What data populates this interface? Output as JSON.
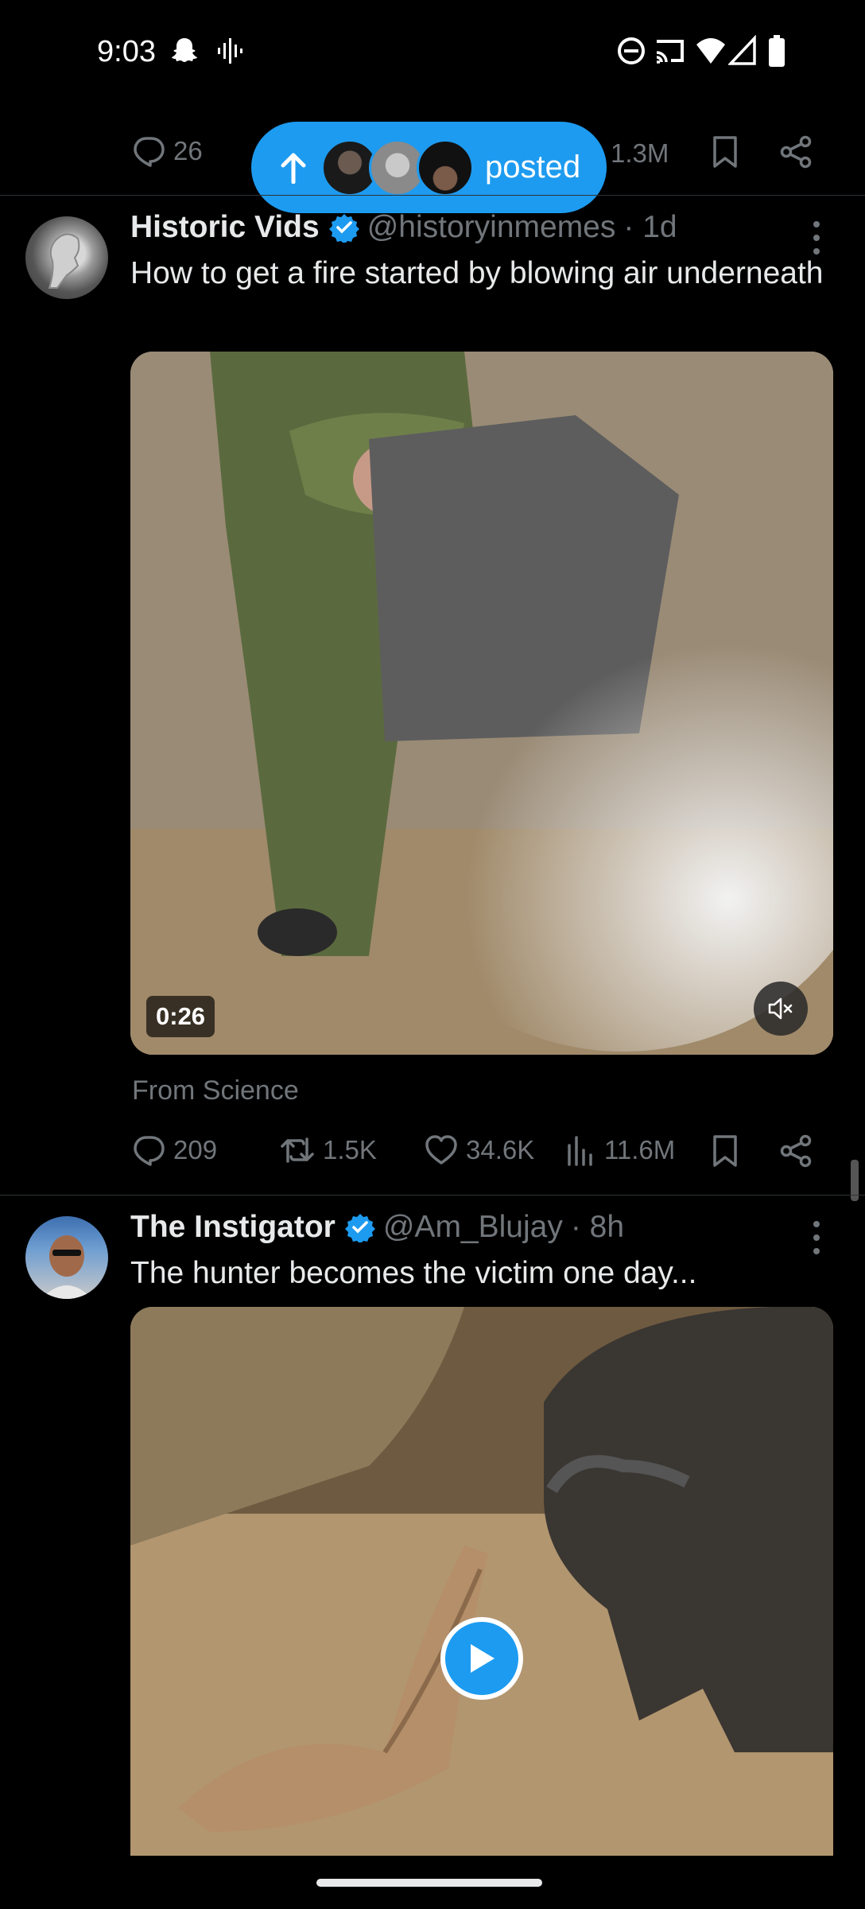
{
  "status_bar": {
    "time": "9:03",
    "left_icons": [
      "snapchat-icon",
      "voice-wave-icon"
    ],
    "right_icons": [
      "dnd-icon",
      "cast-icon",
      "wifi-icon",
      "signal-icon",
      "battery-icon"
    ]
  },
  "previous_tweet": {
    "replies": "26",
    "views": "1.3M"
  },
  "new_posts_pill": {
    "label": "posted"
  },
  "tweets": [
    {
      "display_name": "Historic Vids",
      "handle": "@historyinmemes",
      "time": "· 1d",
      "text": "How to get a fire started by blowing air underneath",
      "video_duration": "0:26",
      "source": "From Science",
      "replies": "209",
      "reposts": "1.5K",
      "likes": "34.6K",
      "views": "11.6M"
    },
    {
      "display_name": "The Instigator",
      "handle": "@Am_Blujay",
      "time": "· 8h",
      "text": "The hunter becomes the victim one day..."
    }
  ],
  "colors": {
    "background": "#000000",
    "accent": "#1d9bf0",
    "text_primary": "#e7e9ea",
    "text_secondary": "#71767b",
    "divider": "#2f3336"
  }
}
